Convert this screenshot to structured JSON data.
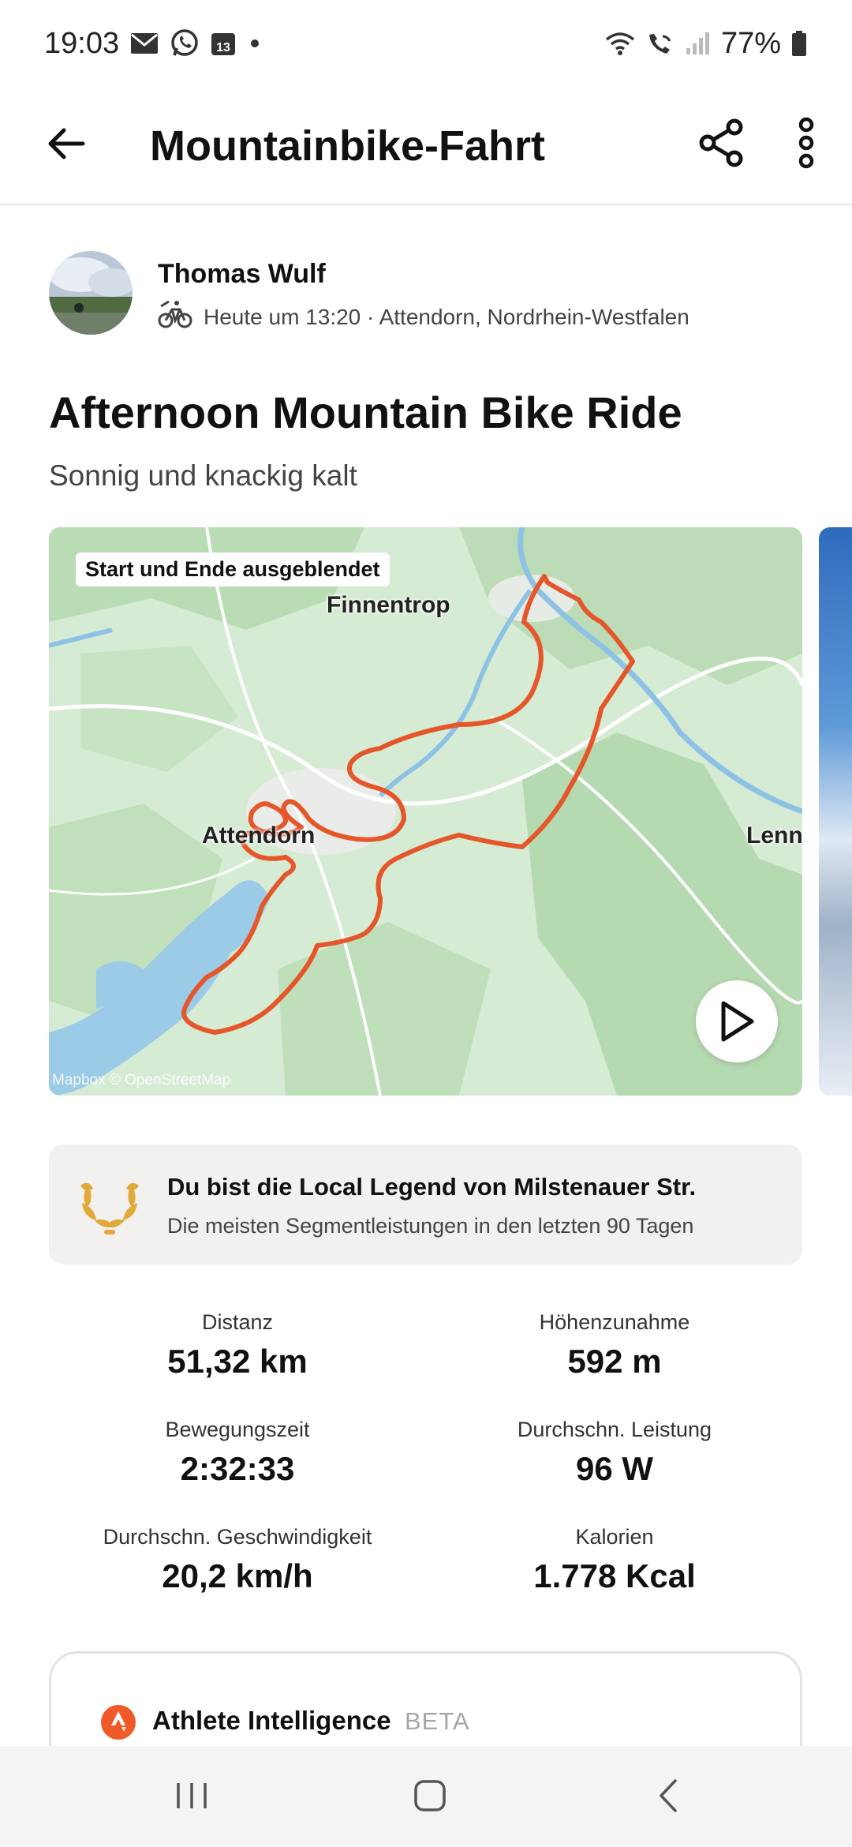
{
  "status_bar": {
    "time": "19:03",
    "calendar_day": "13",
    "battery": "77%",
    "icons": [
      "mail-icon",
      "whatsapp-icon",
      "calendar-icon",
      "dot-icon",
      "wifi-icon",
      "wifi-call-icon",
      "signal-icon",
      "battery-icon"
    ]
  },
  "app_bar": {
    "title": "Mountainbike-Fahrt",
    "icons": [
      "back-arrow-icon",
      "share-icon",
      "more-vertical-icon"
    ]
  },
  "athlete": {
    "name": "Thomas Wulf",
    "meta": "Heute um 13:20 · Attendorn, Nordrhein-Westfalen",
    "activity_icon": "mountain-bike-icon"
  },
  "activity": {
    "title": "Afternoon Mountain Bike Ride",
    "description": "Sonnig und knackig kalt"
  },
  "map": {
    "badge": "Start und Ende ausgeblendet",
    "attribution": "Mapbox © OpenStreetMap",
    "labels": {
      "finnentrop": "Finnentrop",
      "attendorn": "Attendorn",
      "lenne": "Lenn"
    },
    "route_color": "#e5562a",
    "play_icon": "play-icon"
  },
  "local_legend": {
    "title": "Du bist die Local Legend von Milstenauer Str.",
    "subtitle": "Die meisten Segmentleistungen in den letzten 90 Tagen",
    "icon": "laurel-wreath-icon",
    "accent": "#e0a93a"
  },
  "stats": [
    {
      "label": "Distanz",
      "value": "51,32 km"
    },
    {
      "label": "Höhenzunahme",
      "value": "592 m"
    },
    {
      "label": "Bewegungszeit",
      "value": "2:32:33"
    },
    {
      "label": "Durchschn. Leistung",
      "value": "96 W"
    },
    {
      "label": "Durchschn. Geschwindigkeit",
      "value": "20,2 km/h"
    },
    {
      "label": "Kalorien",
      "value": "1.778 Kcal"
    }
  ],
  "athlete_intelligence": {
    "title": "Athlete Intelligence",
    "badge": "BETA",
    "icon": "strava-logo-icon",
    "accent": "#f05a28"
  },
  "nav_bar": {
    "icons": [
      "recent-apps-icon",
      "home-icon",
      "back-icon"
    ]
  }
}
